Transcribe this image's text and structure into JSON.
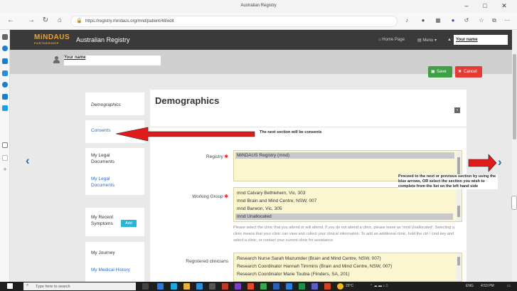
{
  "browser": {
    "window_title": "Australian Registry",
    "url": "https://registry.mindaus.org/mnd/patient/48/edit",
    "controls": {
      "minimize": "–",
      "maximize": "□",
      "close": "✕"
    }
  },
  "header": {
    "logo_main": "MiNDAUS",
    "logo_sub": "PARTNERSHIP",
    "app_title": "Australian Registry",
    "home_link": "Home Page",
    "menu_link": "Menu",
    "user_name": "Your name"
  },
  "userbar": {
    "user_name": "Your name"
  },
  "actions": {
    "save_label": "Save",
    "cancel_label": "Cancel"
  },
  "nav": {
    "demographics": "Demographics",
    "consents": "Consents",
    "my_legal_documents": "My Legal Documents",
    "my_legal_documents_link": "My Legal Documents",
    "my_recent_symptoms": "My Recent Symptoms",
    "add_label": "Add",
    "my_journey": "My Journey",
    "my_medical_history": "My Medical History"
  },
  "main": {
    "title": "Demographics",
    "registry_label": "Registry",
    "registry_options": [
      "MiNDAUS Registry (mnd)"
    ],
    "working_group_label": "Working Group",
    "working_group_options": [
      "mnd Calvary Bethlehem, Vic, 303",
      "mnd Brain and Mind Centre, NSW, 007",
      "mnd Barwon, Vic, 305",
      "mnd Unallocated"
    ],
    "help_text": "Please select the clinic that you attend or will attend. If you do not attend a clinic, please leave as 'mnd Unallocated'. Selecting a clinic means that your clinic can view and collect your clinical information. To add an additional clinic, hold the ctrl / cmd key and select a clinic, or contact your current clinic for assistance.",
    "clinicians_label": "Registered clinicians",
    "clinicians": [
      "Research Nurse Sarah Mazumder (Brain and Mind Centre, NSW, 007)",
      "Research Coordinator Hannah Timmins (Brain and Mind Centre, NSW, 007)",
      "Research Coordinator Marie Toubia (Flinders, SA, 201)"
    ]
  },
  "annotations": {
    "consents_note": "The next section will be consents",
    "nav_note": "Proceed to the next or previous section by using the blue arrows, OR select the section you wish to complete from the list on the left hand side"
  },
  "taskbar": {
    "search_placeholder": "Type here to search",
    "weather": "25°C",
    "lang": "ENG",
    "time": "4:53 PM"
  },
  "colors": {
    "header_bg": "#3a3a3a",
    "logo": "#e8a33b",
    "save": "#3f9f45",
    "cancel": "#e43b32",
    "link": "#2b6cc4",
    "arrow": "#e11b1b",
    "chevron": "#1f6fb8",
    "field_bg": "#fbf6cf"
  }
}
